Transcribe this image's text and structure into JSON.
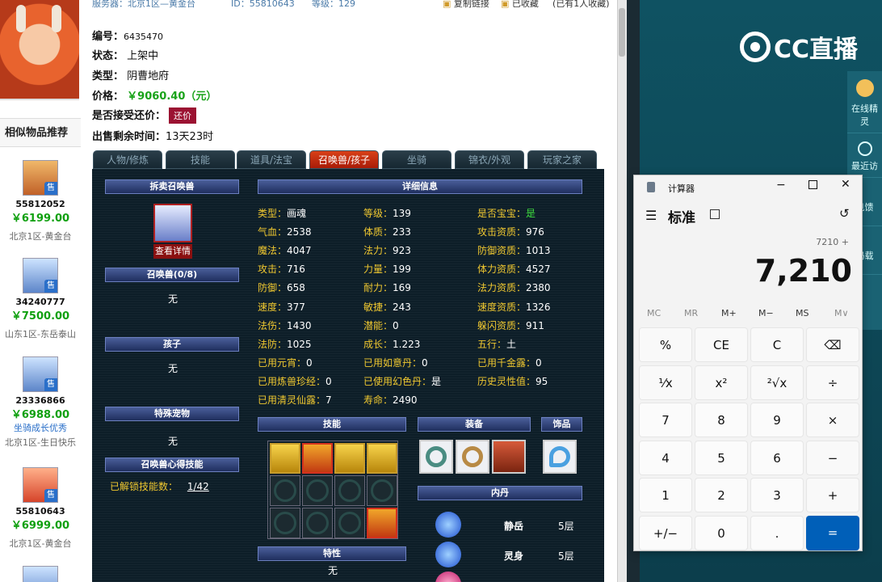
{
  "page": {
    "top": {
      "server": "服务器：北京1区—黄金台",
      "id": "ID：55810643",
      "level": "等级：129",
      "copy": "复制链接",
      "fav": "已收藏",
      "favcount": "(已有1人收藏)"
    },
    "info": {
      "number_label": "编号：",
      "number": "6435470",
      "status_label": "状态：",
      "status": "上架中",
      "type_label": "类型：",
      "type": "阴曹地府",
      "price_label": "价格：",
      "price": "￥9060.40（元）",
      "counter_label": "是否接受还价：",
      "counter_btn": "还价",
      "remain_label": "出售剩余时间：",
      "remain": "13天23时"
    },
    "tabs": [
      "人物/修炼",
      "技能",
      "道具/法宝",
      "召唤兽/孩子",
      "坐骑",
      "锦衣/外观",
      "玩家之家"
    ],
    "left": {
      "sell_title": "拆卖召唤兽",
      "view": "查看详情",
      "pets_title": "召唤兽(0/8)",
      "pets_val": "无",
      "kids_title": "孩子",
      "kids_val": "无",
      "special_title": "特殊宠物",
      "special_val": "无",
      "heart_title": "召唤兽心得技能",
      "heart_label": "已解锁技能数：",
      "heart_val": "1/42"
    },
    "detail_title": "详细信息",
    "stats": [
      [
        "类型：",
        "画魂",
        "等级：",
        "139",
        "是否宝宝：",
        "是"
      ],
      [
        "气血：",
        "2538",
        "体质：",
        "233",
        "攻击资质：",
        "976"
      ],
      [
        "魔法：",
        "4047",
        "法力：",
        "923",
        "防御资质：",
        "1013"
      ],
      [
        "攻击：",
        "716",
        "力量：",
        "199",
        "体力资质：",
        "4527"
      ],
      [
        "防御：",
        "658",
        "耐力：",
        "169",
        "法力资质：",
        "2380"
      ],
      [
        "速度：",
        "377",
        "敏捷：",
        "243",
        "速度资质：",
        "1326"
      ],
      [
        "法伤：",
        "1430",
        "潜能：",
        "0",
        "躲闪资质：",
        "911"
      ],
      [
        "法防：",
        "1025",
        "成长：",
        "1.223",
        "五行：",
        "土"
      ],
      [
        "已用元宵：",
        "0",
        "已用如意丹：",
        "0",
        "已用千金露：",
        "0"
      ],
      [
        "已用炼兽珍经：",
        "0",
        "已使用幻色丹：",
        "是",
        "历史灵性值：",
        "95"
      ],
      [
        "已用清灵仙露：",
        "7",
        "寿命：",
        "2490",
        "",
        ""
      ]
    ],
    "skills_title": "技能",
    "equip_title": "装备",
    "ornament_title": "饰品",
    "neidan_title": "内丹",
    "neidan": [
      {
        "name": "静岳",
        "level": "5层"
      },
      {
        "name": "灵身",
        "level": "5层"
      },
      {
        "name": "",
        "level": ""
      }
    ],
    "trait_title": "特性",
    "trait_val": "无",
    "similar_title": "相似物品推荐",
    "similar": [
      {
        "id": "55812052",
        "price": "￥6199.00",
        "note": "",
        "server": "北京1区-黄金台"
      },
      {
        "id": "34240777",
        "price": "￥7500.00",
        "note": "",
        "server": "山东1区-东岳泰山"
      },
      {
        "id": "23336866",
        "price": "￥6988.00",
        "note": "坐骑成长优秀",
        "server": "北京1区-生日快乐"
      },
      {
        "id": "55810643",
        "price": "￥6999.00",
        "note": "",
        "server": "北京1区-黄金台"
      }
    ],
    "sold_badge": "售"
  },
  "cc": {
    "logo": "CC直播",
    "side1": "在线精灵",
    "side2": "最近访",
    "side3": "见",
    "side4": "馈",
    "side5": "码",
    "side6": "载"
  },
  "calc": {
    "title": "计算器",
    "mode": "标准",
    "expr": "7210 +",
    "display": "7,210",
    "memory": [
      "MC",
      "MR",
      "M+",
      "M−",
      "MS",
      "M∨"
    ],
    "keys": [
      "%",
      "CE",
      "C",
      "⌫",
      "¹⁄x",
      "x²",
      "²√x",
      "÷",
      "7",
      "8",
      "9",
      "×",
      "4",
      "5",
      "6",
      "−",
      "1",
      "2",
      "3",
      "+",
      "+/−",
      "0",
      ".",
      "="
    ]
  }
}
